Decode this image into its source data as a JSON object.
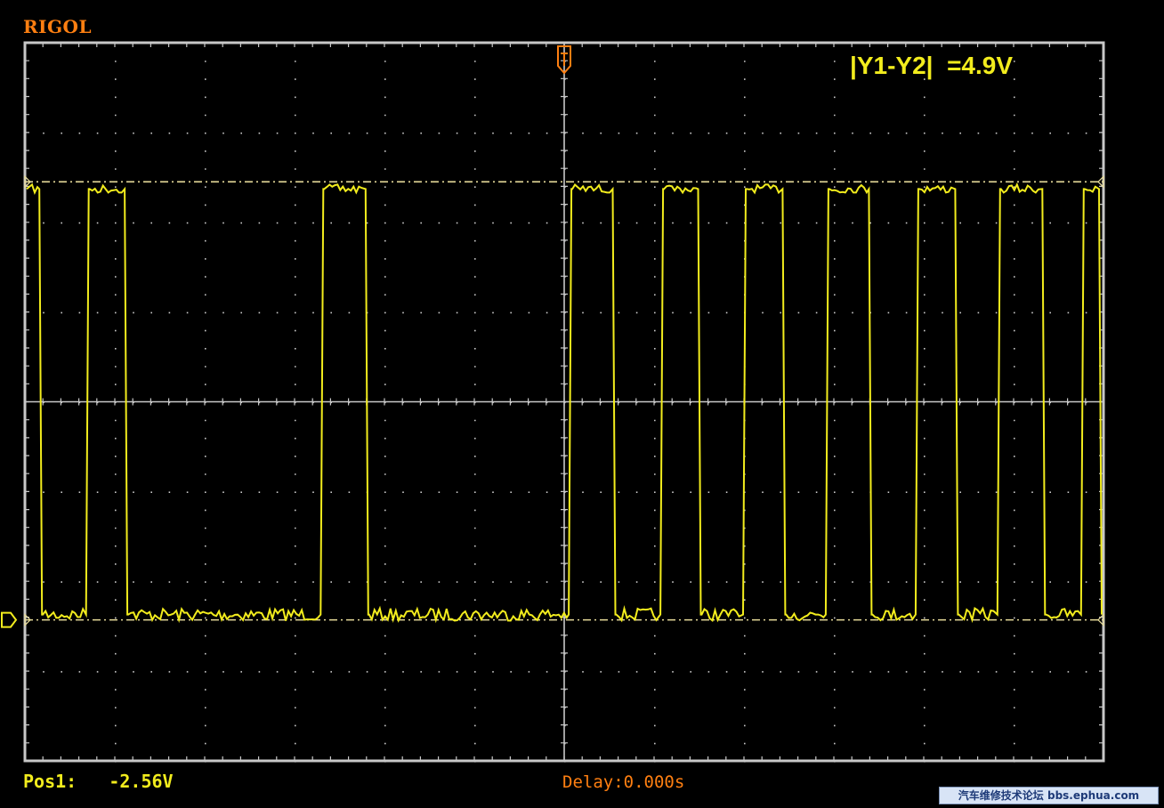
{
  "brand": "RIGOL",
  "measurement": {
    "label": "|Y1-Y2|",
    "value": "=4.9V"
  },
  "position": {
    "label": "Pos1:",
    "value": "-2.56V"
  },
  "delay": "Delay:0.000s",
  "watermark": "汽车维修技术论坛 bbs.ephua.com",
  "colors": {
    "trace": "#f2ec1d",
    "brand": "#ff7f11",
    "grid": "#c8c8c8",
    "cursor": "#e8dc9a",
    "background": "#000000"
  },
  "signal": {
    "high_level": 1,
    "low_level": 0,
    "transitions_div": [
      0.17,
      0.69,
      1.12,
      3.3,
      3.8,
      6.06,
      6.55,
      7.08,
      7.5,
      8.0,
      8.44,
      8.92,
      9.4,
      9.92,
      10.36,
      10.83,
      11.33,
      11.76
    ]
  }
}
